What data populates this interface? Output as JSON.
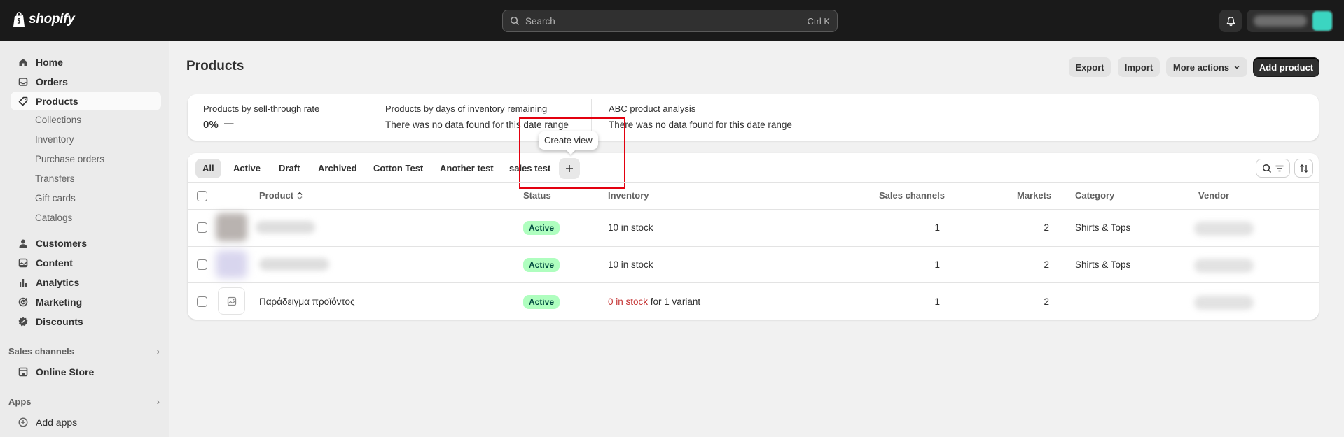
{
  "topbar": {
    "logo_text": "shopify",
    "search_placeholder": "Search",
    "search_shortcut": "Ctrl K"
  },
  "sidebar": {
    "main_items": [
      {
        "label": "Home",
        "icon": "home-icon"
      },
      {
        "label": "Orders",
        "icon": "inbox-icon"
      },
      {
        "label": "Products",
        "icon": "tag-icon",
        "active": true
      }
    ],
    "product_sub_items": [
      "Collections",
      "Inventory",
      "Purchase orders",
      "Transfers",
      "Gift cards",
      "Catalogs"
    ],
    "more_items": [
      {
        "label": "Customers",
        "icon": "person-icon"
      },
      {
        "label": "Content",
        "icon": "image-icon"
      },
      {
        "label": "Analytics",
        "icon": "bar-chart-icon"
      },
      {
        "label": "Marketing",
        "icon": "target-icon"
      },
      {
        "label": "Discounts",
        "icon": "discount-icon"
      }
    ],
    "sales_channels_label": "Sales channels",
    "online_store_label": "Online Store",
    "apps_label": "Apps",
    "add_apps_label": "Add apps"
  },
  "page": {
    "title": "Products",
    "actions": {
      "export": "Export",
      "import": "Import",
      "more_actions": "More actions",
      "add_product": "Add product"
    }
  },
  "metrics": [
    {
      "label": "Products by sell-through rate",
      "value": "0%",
      "dash": "—"
    },
    {
      "label": "Products by days of inventory remaining",
      "text": "There was no data found for this date range"
    },
    {
      "label": "ABC product analysis",
      "text": "There was no data found for this date range"
    }
  ],
  "tabs": [
    "All",
    "Active",
    "Draft",
    "Archived",
    "Cotton Test",
    "Another test",
    "sales test"
  ],
  "tooltip": "Create view",
  "table": {
    "headers": {
      "product": "Product",
      "status": "Status",
      "inventory": "Inventory",
      "sales_channels": "Sales channels",
      "markets": "Markets",
      "category": "Category",
      "vendor": "Vendor"
    },
    "rows": [
      {
        "name": "",
        "status": "Active",
        "inventory": "10 in stock",
        "inventory_suffix": "",
        "sales_channels": "1",
        "markets": "2",
        "category": "Shirts & Tops"
      },
      {
        "name": "",
        "status": "Active",
        "inventory": "10 in stock",
        "inventory_suffix": "",
        "sales_channels": "1",
        "markets": "2",
        "category": "Shirts & Tops"
      },
      {
        "name": "Παράδειγμα προϊόντος",
        "status": "Active",
        "inventory": "0 in stock",
        "inventory_suffix": "for 1 variant",
        "sales_channels": "1",
        "markets": "2",
        "category": ""
      }
    ]
  }
}
